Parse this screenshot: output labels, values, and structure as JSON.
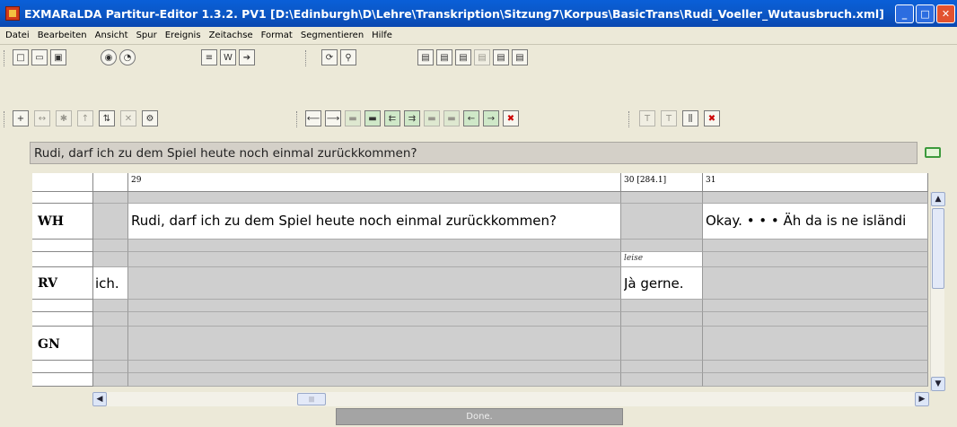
{
  "window": {
    "title": "EXMARaLDA Partitur-Editor 1.3.2. PV1 [D:\\Edinburgh\\D\\Lehre\\Transkription\\Sitzung7\\Korpus\\BasicTrans\\Rudi_Voeller_Wutausbruch.xml]",
    "buttons": {
      "minimize": "_",
      "maximize": "□",
      "close": "✕"
    }
  },
  "menu": [
    "Datei",
    "Bearbeiten",
    "Ansicht",
    "Spur",
    "Ereignis",
    "Zeitachse",
    "Format",
    "Segmentieren",
    "Hilfe"
  ],
  "toolbar": {
    "row1": [
      "new-icon",
      "open-icon",
      "save-icon",
      "speaker-icon",
      "comment-icon",
      "document-icon",
      "word-icon",
      "export-icon",
      "refresh-icon",
      "search-icon",
      "tier-icon-1",
      "tier-icon-2",
      "tier-icon-3",
      "tier-icon-4",
      "tier-icon-5",
      "tier-icon-6"
    ],
    "row2": [
      "add-tier-icon",
      "move-tier-icon",
      "remove-tier-icon",
      "tier-up-icon",
      "tier-insert-icon",
      "tier-delete-icon",
      "tier-props-icon",
      "shift-left-icon",
      "shift-right-icon",
      "merge-icon",
      "split-icon",
      "extend-left-icon",
      "extend-right-icon",
      "shrink-left-icon",
      "shrink-right-icon",
      "move-left-icon",
      "move-right-icon",
      "delete-event-icon",
      "timeline-icon-1",
      "timeline-icon-2",
      "timeline-icon-3",
      "timeline-delete-icon"
    ]
  },
  "segment_field": {
    "value": "Rudi, darf ich zu dem Spiel heute noch einmal zurückkommen?"
  },
  "timeline": {
    "t29": "29",
    "t30": "30 [284.1]",
    "t31": "31"
  },
  "tiers": {
    "wh": {
      "label": "WH",
      "event_29": "Rudi, darf ich zu dem Spiel heute noch einmal zurückkommen?",
      "event_31": "Okay. • • • Äh da is ne isländi"
    },
    "rv": {
      "label": "RV",
      "event_28": "ich.",
      "annotation": "leise",
      "event_30": "Jà gerne."
    },
    "gn": {
      "label": "GN"
    }
  },
  "status": {
    "text": "Done."
  },
  "colors": {
    "titlebar": "#0a5fd8",
    "window_bg": "#ece9d8",
    "cell_grey": "#cfcfcf"
  }
}
